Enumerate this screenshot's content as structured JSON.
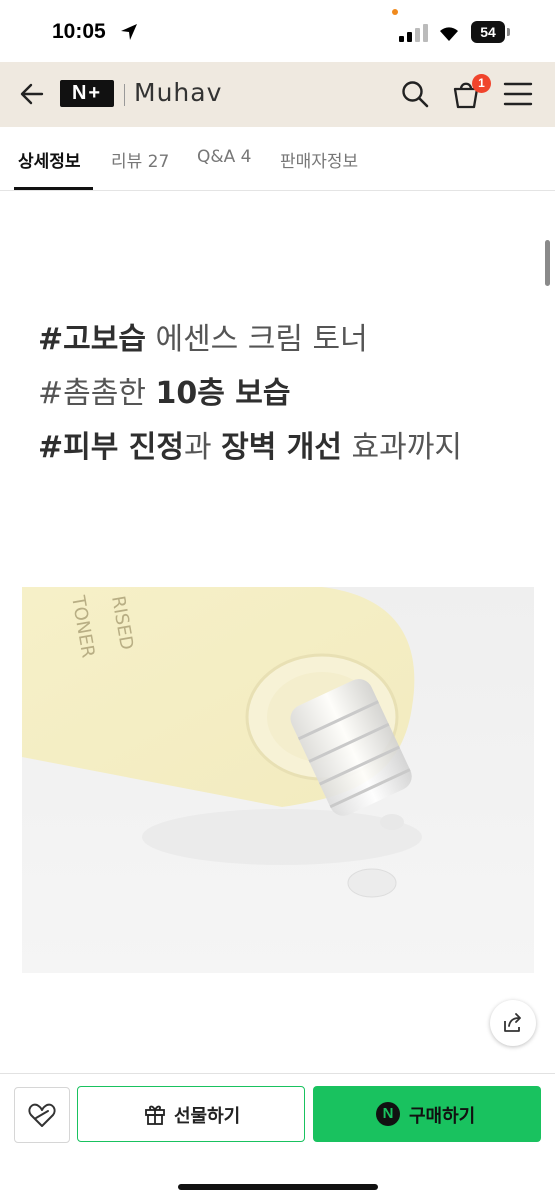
{
  "status_bar": {
    "time": "10:05",
    "battery": "54"
  },
  "header": {
    "logo_badge": "N+",
    "brand_name": "Muhav",
    "cart_count": "1"
  },
  "tabs": [
    {
      "label": "상세정보"
    },
    {
      "label": "리뷰 27"
    },
    {
      "label": "Q&A 4"
    },
    {
      "label": "판매자정보"
    }
  ],
  "content": {
    "headline": {
      "line1": {
        "bold": "#고보습",
        "rest": " 에센스 크림 토너"
      },
      "line2": {
        "a": "#촘촘한 ",
        "bold": "10층 보습"
      },
      "line3": {
        "bold1": "#피부 진정",
        "mid": "과 ",
        "bold2": "장벽 개선",
        "rest": " 효과까지"
      }
    },
    "product_print_1": "TONER",
    "product_print_2": "RISED"
  },
  "bottom_bar": {
    "gift_label": "선물하기",
    "buy_logo": "N",
    "buy_label": "구매하기"
  },
  "colors": {
    "accent_green": "#19c25f",
    "header_bg": "#efe9e0",
    "badge_red": "#f0442c"
  },
  "icons": [
    "location-arrow-icon",
    "signal-icon",
    "wifi-icon",
    "battery-icon",
    "back-arrow-icon",
    "search-icon",
    "cart-icon",
    "menu-icon",
    "share-icon",
    "like-icon",
    "gift-icon"
  ]
}
